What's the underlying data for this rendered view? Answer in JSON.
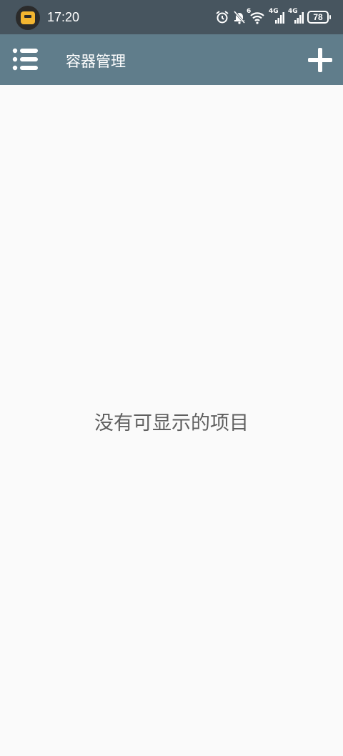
{
  "status_bar": {
    "time": "17:20",
    "network_1": "4G",
    "network_2": "4G",
    "wifi_badge": "6",
    "battery_level": "78",
    "icons": [
      "app-badge-icon",
      "alarm-icon",
      "mute-bell-icon",
      "wifi-icon",
      "signal-icon",
      "signal-icon",
      "battery-icon"
    ]
  },
  "toolbar": {
    "title": "容器管理",
    "menu_icon": "list-menu-icon",
    "add_icon": "plus-icon",
    "background": "#607d8b"
  },
  "main": {
    "empty_message": "没有可显示的项目"
  },
  "colors": {
    "status_bar": "#47555f",
    "toolbar": "#607d8b",
    "background": "#fafafa",
    "empty_text": "#5f5f5f"
  }
}
